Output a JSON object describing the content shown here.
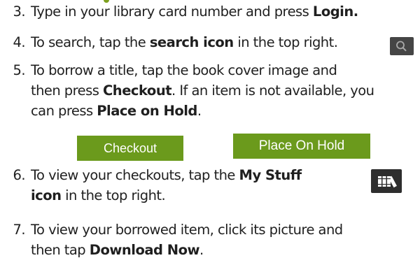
{
  "steps": [
    {
      "number": "3.",
      "lines": [
        [
          {
            "text": "Type in your library card number and press ",
            "bold": false
          },
          {
            "text": "Login.",
            "bold": true
          }
        ]
      ]
    },
    {
      "number": "4.",
      "lines": [
        [
          {
            "text": "To search, tap the ",
            "bold": false
          },
          {
            "text": "search icon",
            "bold": true
          },
          {
            "text": " in the top right.",
            "bold": false
          }
        ]
      ]
    },
    {
      "number": "5.",
      "lines": [
        [
          {
            "text": "To borrow a title, tap the book cover image and",
            "bold": false
          }
        ],
        [
          {
            "text": "then press ",
            "bold": false
          },
          {
            "text": "Checkout",
            "bold": true
          },
          {
            "text": ". If an item is not available, you",
            "bold": false
          }
        ],
        [
          {
            "text": "can press ",
            "bold": false
          },
          {
            "text": "Place on Hold",
            "bold": true
          },
          {
            "text": ".",
            "bold": false
          }
        ]
      ]
    },
    {
      "number": "6.",
      "lines": [
        [
          {
            "text": "To view your checkouts, tap the ",
            "bold": false
          },
          {
            "text": "My Stuff",
            "bold": true
          }
        ],
        [
          {
            "text": "icon",
            "bold": true
          },
          {
            "text": " in the top right.",
            "bold": false
          }
        ]
      ]
    },
    {
      "number": "7.",
      "lines": [
        [
          {
            "text": "To view your borrowed item, click its picture and",
            "bold": false
          }
        ],
        [
          {
            "text": "then tap ",
            "bold": false
          },
          {
            "text": "Download Now",
            "bold": true
          },
          {
            "text": ".",
            "bold": false
          }
        ]
      ]
    }
  ],
  "buttons": {
    "checkout_label": "Checkout",
    "place_on_hold_label": "Place On Hold"
  },
  "icons": {
    "search": "search-icon",
    "my_stuff": "my-stuff-icon"
  },
  "colors": {
    "button_green": "#6b9a1c",
    "icon_background": "#454545",
    "text": "#1f1f1f"
  }
}
